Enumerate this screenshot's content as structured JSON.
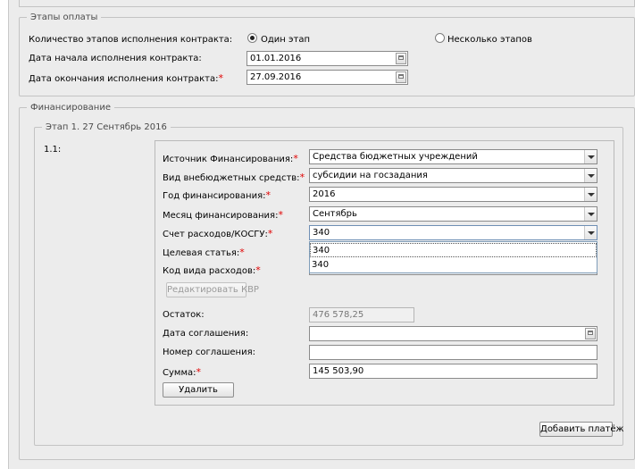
{
  "payment_stages": {
    "legend": "Этапы оплаты",
    "count_label": "Количество этапов исполнения контракта:",
    "option_single": "Один этап",
    "option_multiple": "Несколько этапов",
    "start_label": "Дата начала исполнения контракта:",
    "start_value": "01.01.2016",
    "end_label": "Дата окончания исполнения контракта:",
    "end_value": "27.09.2016"
  },
  "financing": {
    "legend": "Финансирование",
    "stage_legend": "Этап 1. 27 Сентябрь 2016",
    "item_number": "1.1:",
    "source_label": "Источник Финансирования:",
    "source_value": "Средства бюджетных учреждений",
    "extra_funds_label": "Вид внебюджетных средств:",
    "extra_funds_value": "субсидии на госзадания",
    "year_label": "Год финансирования:",
    "year_value": "2016",
    "month_label": "Месяц финансирования:",
    "month_value": "Сентябрь",
    "kosgu_label": "Счет расходов/КОСГУ:",
    "kosgu_value": "340",
    "kosgu_options": [
      "340",
      "340"
    ],
    "target_label": "Целевая статья:",
    "kvr_label": "Код вида расходов:",
    "edit_kvr_button": "Редактировать КВР",
    "balance_label": "Остаток:",
    "balance_value": "476 578,25",
    "agreement_date_label": "Дата соглашения:",
    "agreement_date_value": "",
    "agreement_number_label": "Номер соглашения:",
    "agreement_number_value": "",
    "sum_label": "Сумма:",
    "sum_value": "145 503,90",
    "delete_button": "Удалить",
    "add_payment_button": "Добавить платёж",
    "required_mark": "*"
  }
}
